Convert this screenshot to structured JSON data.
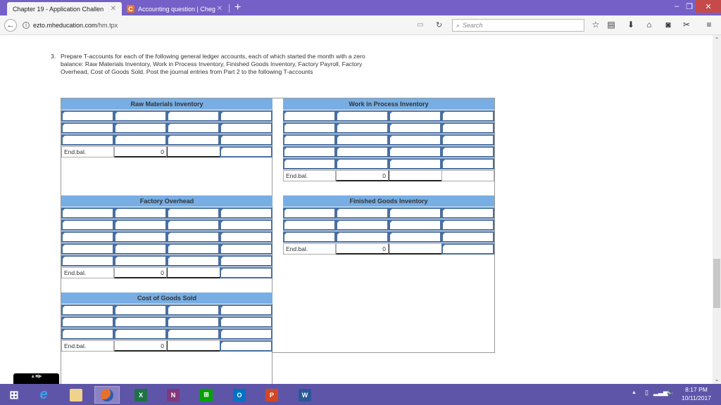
{
  "browser": {
    "tabs": [
      {
        "label": "Chapter 19 - Application Challen",
        "active": true
      },
      {
        "label": "Accounting question | Cheg",
        "active": false,
        "favicon": "C"
      }
    ],
    "url_domain": "ezto.mheducation.com",
    "url_path": "/hm.tpx",
    "search_placeholder": "Search",
    "icons": [
      "star-icon",
      "reading-list-icon",
      "download-icon",
      "home-icon",
      "pocket-icon",
      "extension-icon",
      "menu-icon"
    ]
  },
  "question": {
    "number": "3.",
    "text": "Prepare T-accounts for each of the following general ledger accounts, each of which started the month with a zero balance: Raw Materials Inventory, Work in Process Inventory, Finished Goods Inventory, Factory Payroll, Factory Overhead, Cost of Goods Sold. Post the journal entries from Part 2 to the following T-accounts"
  },
  "t_accounts": [
    {
      "title": "Raw Materials Inventory",
      "entry_rows": 3,
      "end_label": "End.bal.",
      "end_value": "0"
    },
    {
      "title": "Work in Process Inventory",
      "entry_rows": 5,
      "end_label": "End.bal.",
      "end_value": "0"
    },
    {
      "title": "Factory Overhead",
      "entry_rows": 5,
      "end_label": "End.bal.",
      "end_value": "0"
    },
    {
      "title": "Finished Goods Inventory",
      "entry_rows": 3,
      "end_label": "End.bal.",
      "end_value": "0"
    },
    {
      "title": "Cost of Goods Sold",
      "entry_rows": 3,
      "end_label": "End.bal.",
      "end_value": "0"
    }
  ],
  "taskbar": {
    "apps": [
      "start",
      "internet-explorer",
      "file-explorer",
      "firefox",
      "excel",
      "onenote",
      "store",
      "outlook",
      "powerpoint",
      "word"
    ],
    "app_letters": {
      "excel": "X",
      "onenote": "N",
      "outlook": "O",
      "powerpoint": "P",
      "word": "W"
    },
    "time": "8:17 PM",
    "date": "10/11/2017"
  }
}
